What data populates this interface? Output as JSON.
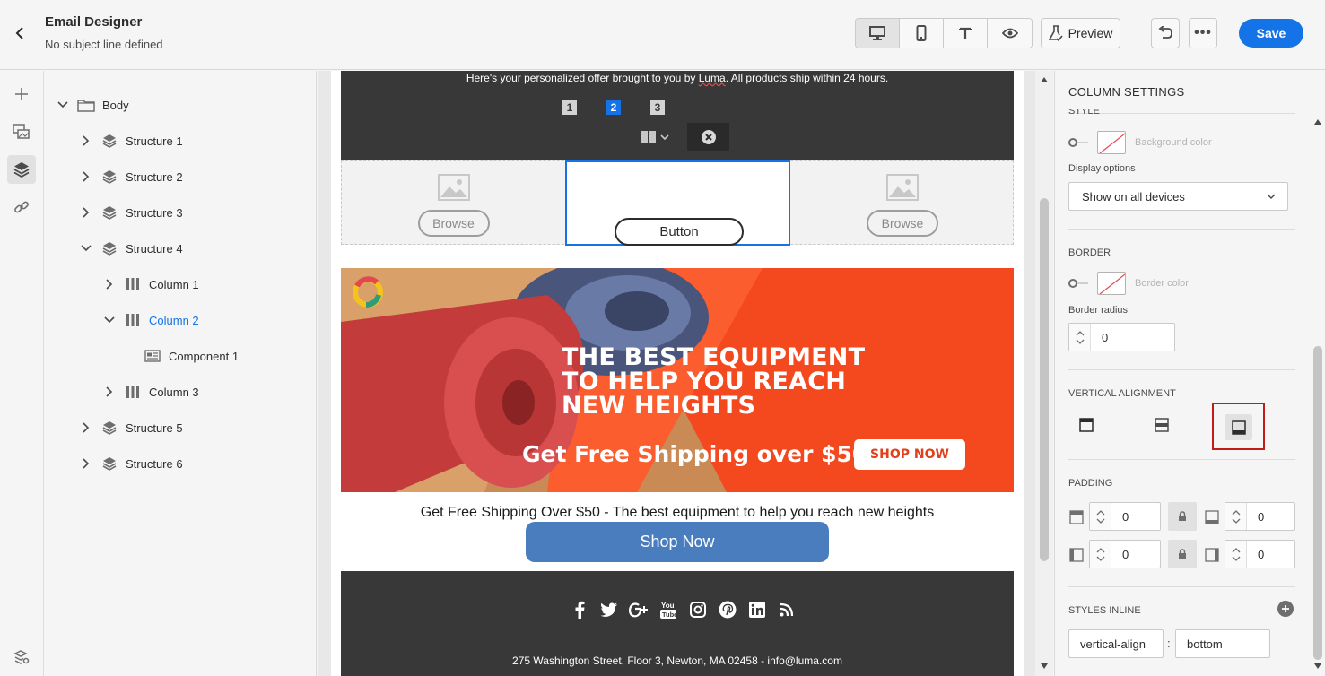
{
  "header": {
    "title": "Email Designer",
    "subtitle": "No subject line defined",
    "preview_label": "Preview",
    "save_label": "Save",
    "more_label": "•••"
  },
  "tree": {
    "items": [
      {
        "label": "Body"
      },
      {
        "label": "Structure 1"
      },
      {
        "label": "Structure 2"
      },
      {
        "label": "Structure 3"
      },
      {
        "label": "Structure 4"
      },
      {
        "label": "Column 1"
      },
      {
        "label": "Column 2"
      },
      {
        "label": "Component 1"
      },
      {
        "label": "Column 3"
      },
      {
        "label": "Structure 5"
      },
      {
        "label": "Structure 6"
      }
    ]
  },
  "email": {
    "offer_pre": "Here's your personalized offer brought to you by ",
    "offer_brand": "Luma",
    "offer_post": ". All products ship within 24 hours.",
    "column_numbers": [
      "1",
      "2",
      "3"
    ],
    "browse_label": "Browse",
    "button_label": "Button",
    "hero_line1": "THE BEST EQUIPMENT",
    "hero_line2": "TO HELP YOU REACH",
    "hero_line3": "NEW HEIGHTS",
    "hero_shipping": "Get Free Shipping over $50",
    "hero_shop": "SHOP NOW",
    "promo_text": "Get Free Shipping Over $50 - The best equipment to help you reach new heights",
    "shop_button": "Shop Now",
    "social_icons": [
      "facebook-icon",
      "twitter-icon",
      "google-plus-icon",
      "youtube-icon",
      "instagram-icon",
      "pinterest-icon",
      "linkedin-icon",
      "rss-icon"
    ],
    "address": "275 Washington Street, Floor 3, Newton, MA 02458 - info@luma.com"
  },
  "panel": {
    "title": "COLUMN SETTINGS",
    "style_label": "STYLE",
    "background_color_label": "Background color",
    "display_options_label": "Display options",
    "display_options_value": "Show on all devices",
    "border_label": "BORDER",
    "border_color_label": "Border color",
    "border_radius_label": "Border radius",
    "border_radius_value": "0",
    "vertical_alignment_label": "VERTICAL ALIGNMENT",
    "vertical_alignment_selected": "bottom",
    "padding_label": "PADDING",
    "padding_top": "0",
    "padding_bottom": "0",
    "padding_left": "0",
    "padding_right": "0",
    "styles_inline_label": "STYLES INLINE",
    "inline_property": "vertical-align",
    "inline_value": "bottom",
    "colon": ":"
  },
  "colors": {
    "accent": "#1473e6",
    "dark_band": "#383838",
    "hero_orange": "#f4491f",
    "shop_button": "#4a7dbd",
    "highlight_border": "#c11c1c"
  }
}
